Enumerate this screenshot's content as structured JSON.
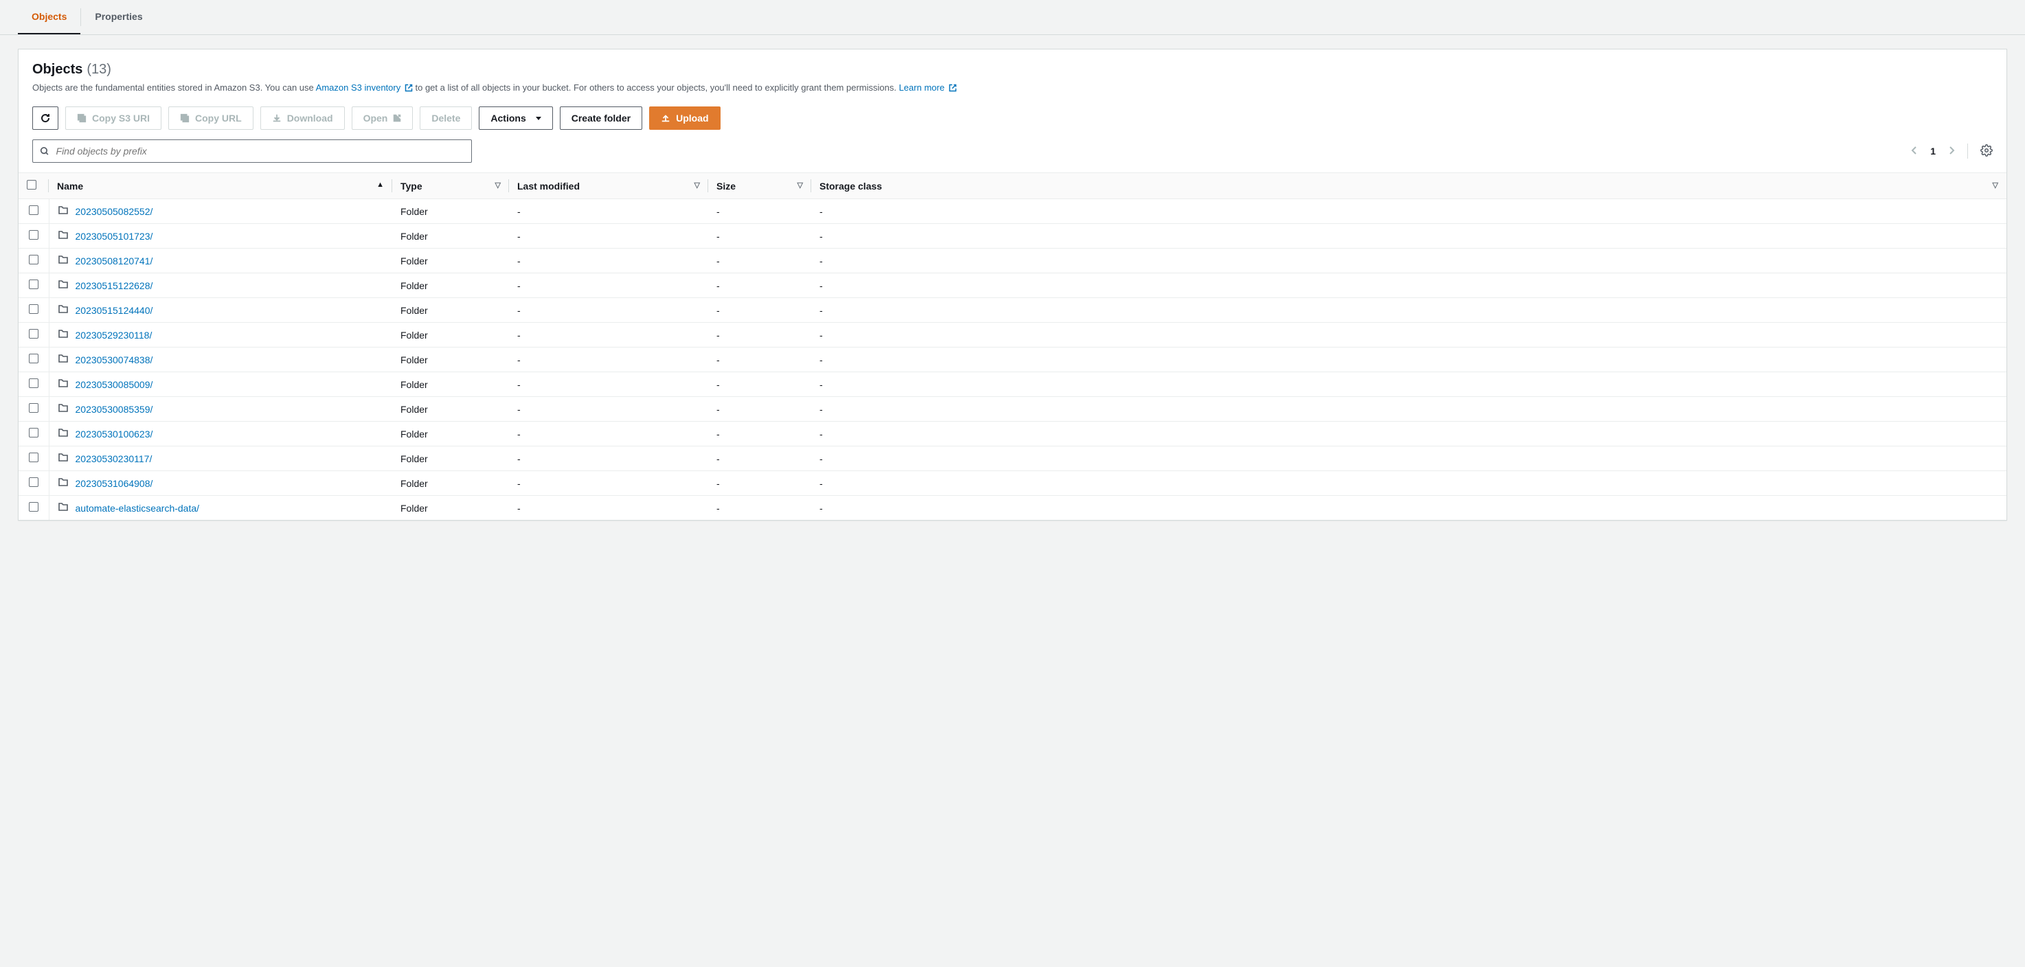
{
  "tabs": {
    "objects": "Objects",
    "properties": "Properties"
  },
  "header": {
    "title": "Objects",
    "count": "(13)",
    "desc_pre": "Objects are the fundamental entities stored in Amazon S3. You can use ",
    "desc_link1": "Amazon S3 inventory",
    "desc_mid": " to get a list of all objects in your bucket. For others to access your objects, you'll need to explicitly grant them permissions. ",
    "desc_link2": "Learn more"
  },
  "toolbar": {
    "copy_s3": "Copy S3 URI",
    "copy_url": "Copy URL",
    "download": "Download",
    "open": "Open",
    "delete": "Delete",
    "actions": "Actions",
    "create_folder": "Create folder",
    "upload": "Upload"
  },
  "search": {
    "placeholder": "Find objects by prefix"
  },
  "pager": {
    "page": "1"
  },
  "columns": {
    "name": "Name",
    "type": "Type",
    "last_modified": "Last modified",
    "size": "Size",
    "storage_class": "Storage class"
  },
  "rows": [
    {
      "name": "20230505082552/",
      "type": "Folder",
      "last_modified": "-",
      "size": "-",
      "storage_class": "-"
    },
    {
      "name": "20230505101723/",
      "type": "Folder",
      "last_modified": "-",
      "size": "-",
      "storage_class": "-"
    },
    {
      "name": "20230508120741/",
      "type": "Folder",
      "last_modified": "-",
      "size": "-",
      "storage_class": "-"
    },
    {
      "name": "20230515122628/",
      "type": "Folder",
      "last_modified": "-",
      "size": "-",
      "storage_class": "-"
    },
    {
      "name": "20230515124440/",
      "type": "Folder",
      "last_modified": "-",
      "size": "-",
      "storage_class": "-"
    },
    {
      "name": "20230529230118/",
      "type": "Folder",
      "last_modified": "-",
      "size": "-",
      "storage_class": "-"
    },
    {
      "name": "20230530074838/",
      "type": "Folder",
      "last_modified": "-",
      "size": "-",
      "storage_class": "-"
    },
    {
      "name": "20230530085009/",
      "type": "Folder",
      "last_modified": "-",
      "size": "-",
      "storage_class": "-"
    },
    {
      "name": "20230530085359/",
      "type": "Folder",
      "last_modified": "-",
      "size": "-",
      "storage_class": "-"
    },
    {
      "name": "20230530100623/",
      "type": "Folder",
      "last_modified": "-",
      "size": "-",
      "storage_class": "-"
    },
    {
      "name": "20230530230117/",
      "type": "Folder",
      "last_modified": "-",
      "size": "-",
      "storage_class": "-"
    },
    {
      "name": "20230531064908/",
      "type": "Folder",
      "last_modified": "-",
      "size": "-",
      "storage_class": "-"
    },
    {
      "name": "automate-elasticsearch-data/",
      "type": "Folder",
      "last_modified": "-",
      "size": "-",
      "storage_class": "-"
    }
  ]
}
